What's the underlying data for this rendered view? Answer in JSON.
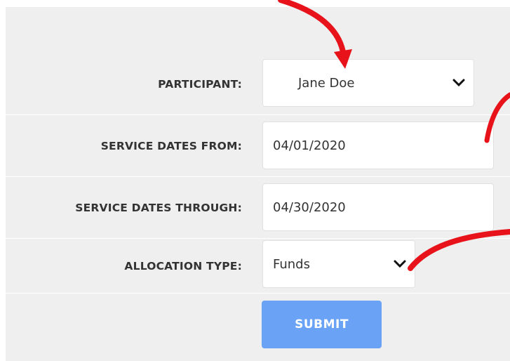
{
  "form": {
    "participant": {
      "label": "PARTICIPANT:",
      "value": "Jane Doe"
    },
    "service_from": {
      "label": "SERVICE DATES FROM:",
      "value": "04/01/2020"
    },
    "service_through": {
      "label": "SERVICE DATES THROUGH:",
      "value": "04/30/2020"
    },
    "allocation_type": {
      "label": "ALLOCATION TYPE:",
      "value": "Funds"
    },
    "submit_label": "SUBMIT"
  },
  "icons": {
    "dropdown": "chevron-down-icon"
  },
  "colors": {
    "submit": "#6aa3f5",
    "annotation": "#e8131a",
    "panel": "#efefef"
  }
}
